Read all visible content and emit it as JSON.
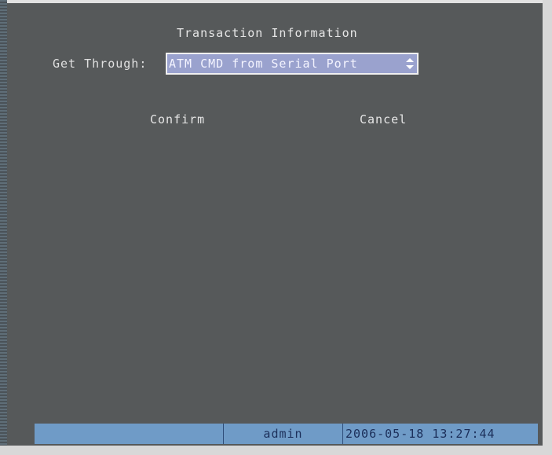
{
  "dialog": {
    "title": "Transaction Information",
    "get_through_label": "Get Through:",
    "get_through_value": "ATM CMD from Serial Port",
    "confirm_label": "Confirm",
    "cancel_label": "Cancel"
  },
  "status_bar": {
    "user": "admin",
    "datetime": "2006-05-18 13:27:44"
  },
  "icons": {
    "select_arrows": "up-down-arrows-icon"
  },
  "colors": {
    "background": "#56595a",
    "select_fill": "#9aa2ce",
    "status_bar": "#6f9bc7",
    "text": "#e6e6e6"
  }
}
